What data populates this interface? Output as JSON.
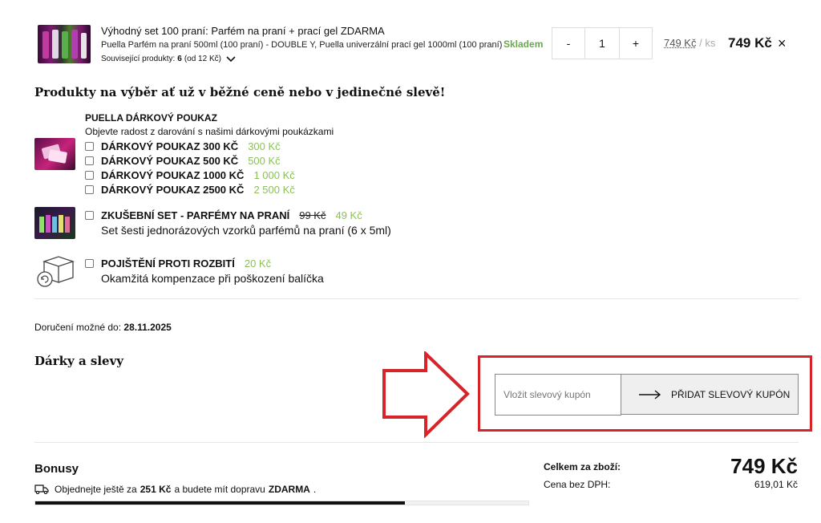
{
  "cart_item": {
    "title": "Výhodný set 100 praní: Parfém na praní + prací gel ZDARMA",
    "subtitle": "Puella Parfém na praní 500ml (100 praní) - DOUBLE Y, Puella univerzální prací gel 1000ml (100 praní)",
    "related_label": "Související produkty:",
    "related_count": "6",
    "related_from": "(od 12 Kč)",
    "stock": "Skladem",
    "qty_minus": "-",
    "qty_value": "1",
    "qty_plus": "+",
    "unit_price": "749 Kč",
    "unit_suffix": "/ ks",
    "total_price": "749 Kč",
    "remove": "×"
  },
  "upsell": {
    "heading": "Produkty na výběr ať už v běžné ceně nebo v jedinečné slevě!",
    "voucher": {
      "title": "PUELLA DÁRKOVÝ POUKAZ",
      "desc": "Objevte radost z darování s našimi dárkovými poukázkami",
      "options": [
        {
          "name": "DÁRKOVÝ POUKAZ 300 KČ",
          "price": "300 Kč"
        },
        {
          "name": "DÁRKOVÝ POUKAZ 500 KČ",
          "price": "500 Kč"
        },
        {
          "name": "DÁRKOVÝ POUKAZ 1000 KČ",
          "price": "1 000 Kč"
        },
        {
          "name": "DÁRKOVÝ POUKAZ 2500 KČ",
          "price": "2 500 Kč"
        }
      ]
    },
    "sample_set": {
      "name": "ZKUŠEBNÍ SET - PARFÉMY NA PRANÍ",
      "old_price": "99 Kč",
      "price": "49 Kč",
      "desc": "Set šesti jednorázových vzorků parfémů na praní (6 x 5ml)"
    },
    "insurance": {
      "name": "POJIŠTĚNÍ PROTI ROZBITÍ",
      "price": "20 Kč",
      "desc": "Okamžitá kompenzace při poškození balíčka"
    }
  },
  "delivery": {
    "label": "Doručení možné do:",
    "date": "28.11.2025"
  },
  "gifts": {
    "heading": "Dárky a slevy",
    "coupon_placeholder": "Vložit slevový kupón",
    "coupon_button": "PŘIDAT SLEVOVÝ KUPÓN"
  },
  "bonus": {
    "heading": "Bonusy",
    "text_prefix": "Objednejte ještě za",
    "amount": "251 Kč",
    "text_mid": "a budete mít dopravu",
    "free": "ZDARMA",
    "progress": 0.75
  },
  "totals": {
    "label": "Celkem za zboží:",
    "total": "749 Kč",
    "no_vat_label": "Cena bez DPH:",
    "no_vat": "619,01 Kč"
  },
  "colors": {
    "accent_green": "#6aa84f",
    "annotation_red": "#d6252a"
  },
  "icons": {
    "chevron": "chevron-down-icon",
    "truck": "truck-icon",
    "arrow": "arrow-right-icon",
    "box": "box-insurance-icon"
  }
}
